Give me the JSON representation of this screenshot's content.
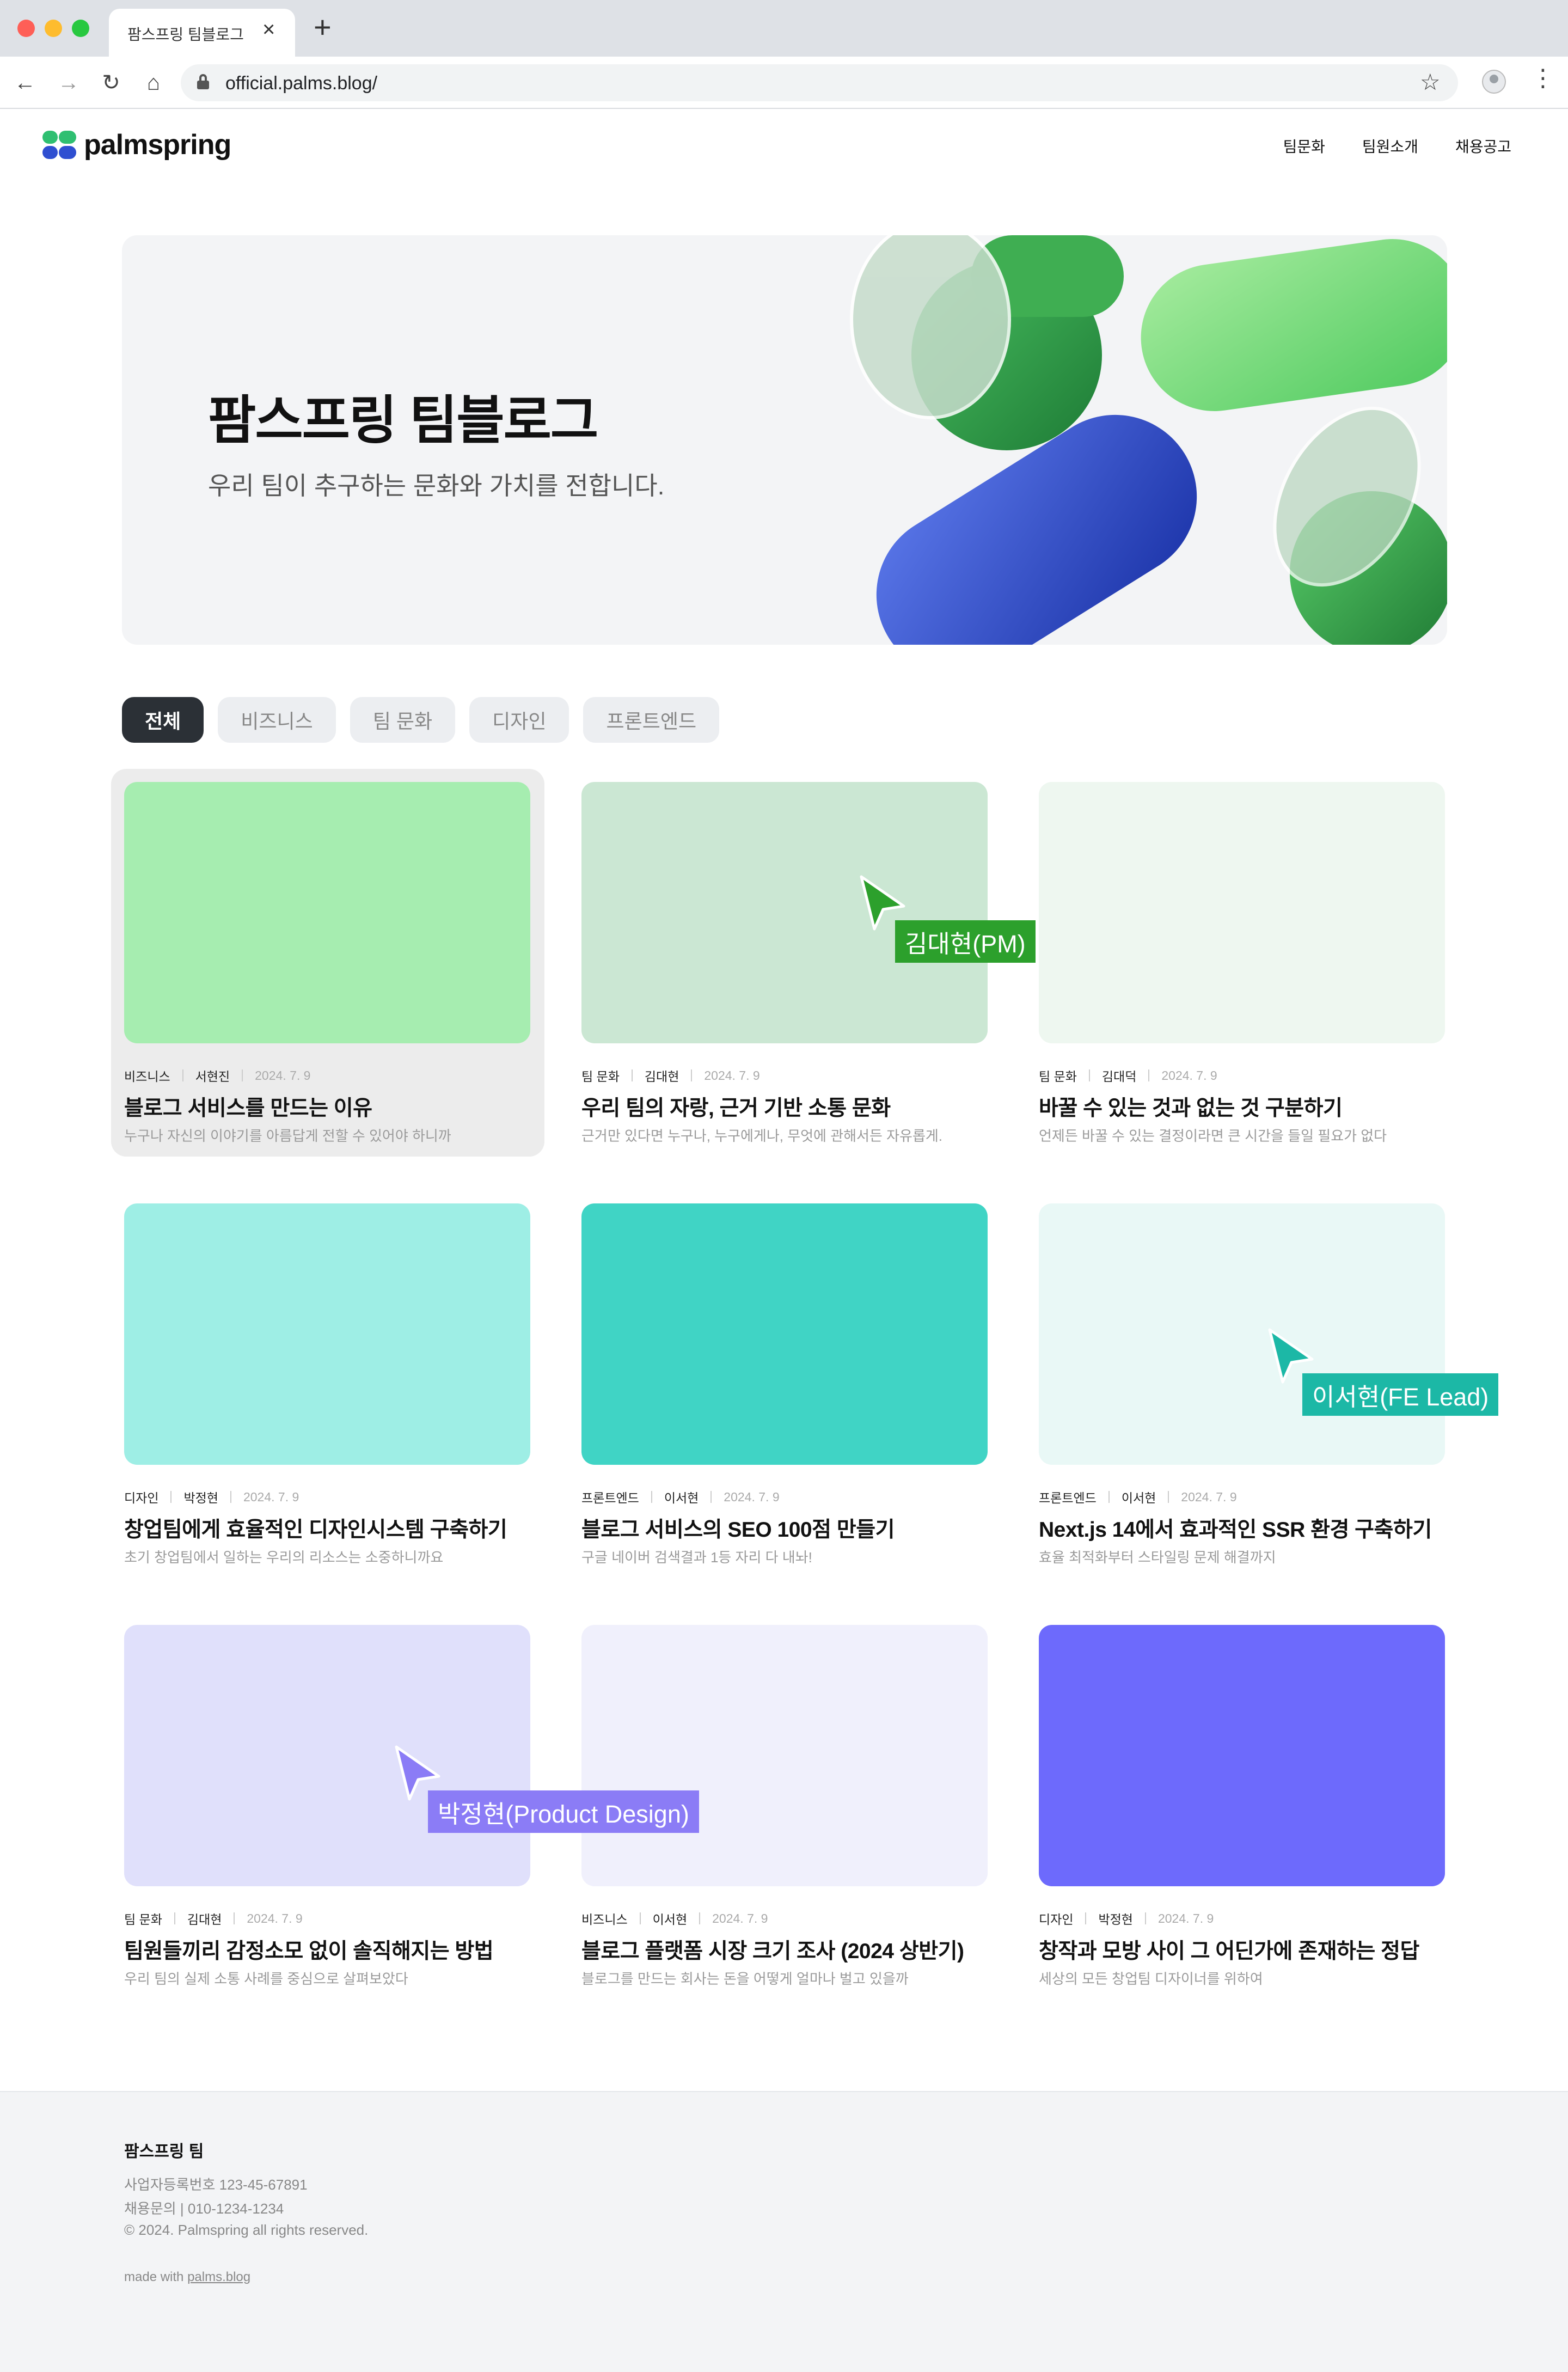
{
  "browser": {
    "tab_title": "팜스프링 팀블로그",
    "url": "official.palms.blog/"
  },
  "site": {
    "logo_text": "palmspring",
    "nav": [
      {
        "label": "팀문화"
      },
      {
        "label": "팀원소개"
      },
      {
        "label": "채용공고"
      }
    ]
  },
  "hero": {
    "title": "팜스프링 팀블로그",
    "subtitle": "우리 팀이 추구하는 문화와 가치를 전합니다."
  },
  "categories": [
    {
      "label": "전체",
      "active": true
    },
    {
      "label": "비즈니스"
    },
    {
      "label": "팀 문화"
    },
    {
      "label": "디자인"
    },
    {
      "label": "프론트엔드"
    }
  ],
  "posts": [
    {
      "category": "비즈니스",
      "author": "서현진",
      "date": "2024. 7. 9",
      "title": "블로그 서비스를 만드는 이유",
      "excerpt": "누구나 자신의 이야기를 아름답게 전할 수 있어야 하니까",
      "thumb_color": "#a6edb0",
      "hovered": true
    },
    {
      "category": "팀 문화",
      "author": "김대현",
      "date": "2024. 7. 9",
      "title": "우리 팀의 자랑, 근거 기반 소통 문화",
      "excerpt": "근거만 있다면 누구나, 누구에게나, 무엇에 관해서든 자유롭게.",
      "thumb_color": "#cbe7d3"
    },
    {
      "category": "팀 문화",
      "author": "김대덕",
      "date": "2024. 7. 9",
      "title": "바꿀 수 있는 것과 없는 것 구분하기",
      "excerpt": "언제든 바꿀 수 있는 결정이라면 큰 시간을 들일 필요가 없다",
      "thumb_color": "#eef7f0"
    },
    {
      "category": "디자인",
      "author": "박정현",
      "date": "2024. 7. 9",
      "title": "창업팀에게 효율적인 디자인시스템 구축하기",
      "excerpt": "초기 창업팀에서 일하는 우리의 리소스는 소중하니까요",
      "thumb_color": "#9eeee5"
    },
    {
      "category": "프론트엔드",
      "author": "이서현",
      "date": "2024. 7. 9",
      "title": "블로그 서비스의 SEO 100점 만들기",
      "excerpt": "구글 네이버 검색결과 1등 자리 다 내놔!",
      "thumb_color": "#40d4c5"
    },
    {
      "category": "프론트엔드",
      "author": "이서현",
      "date": "2024. 7. 9",
      "title": "Next.js 14에서 효과적인 SSR 환경 구축하기",
      "excerpt": "효율 최적화부터 스타일링 문제 해결까지",
      "thumb_color": "#e9f8f6"
    },
    {
      "category": "팀 문화",
      "author": "김대현",
      "date": "2024. 7. 9",
      "title": "팀원들끼리 감정소모 없이 솔직해지는 방법",
      "excerpt": "우리 팀의 실제 소통 사례를 중심으로 살펴보았다",
      "thumb_color": "#e0e0fb"
    },
    {
      "category": "비즈니스",
      "author": "이서현",
      "date": "2024. 7. 9",
      "title": "블로그 플랫폼 시장 크기 조사 (2024 상반기)",
      "excerpt": "블로그를 만드는 회사는 돈을 어떻게 얼마나 벌고 있을까",
      "thumb_color": "#f0f0fc"
    },
    {
      "category": "디자인",
      "author": "박정현",
      "date": "2024. 7. 9",
      "title": "창작과 모방 사이 그 어딘가에 존재하는 정답",
      "excerpt": "세상의 모든 창업팀 디자이너를 위하여",
      "thumb_color": "#6d6afc"
    }
  ],
  "cursors": [
    {
      "label": "김대현(PM)",
      "color": "#2ca02c"
    },
    {
      "label": "이서현(FE Lead)",
      "color": "#1cb8a6"
    },
    {
      "label": "박정현(Product Design)",
      "color": "#8b7cf6"
    }
  ],
  "footer": {
    "name": "팜스프링 팀",
    "biz_no": "사업자등록번호 123-45-67891",
    "contact": "채용문의 | 010-1234-1234",
    "copyright": "© 2024. Palmspring all rights reserved.",
    "made_with_prefix": "made with",
    "made_with_link": "palms.blog"
  },
  "icons": {
    "back": "arrow-left-icon",
    "forward": "arrow-right-icon",
    "reload": "reload-icon",
    "home": "home-icon",
    "lock": "lock-icon",
    "bookmark": "star-icon",
    "profile": "profile-icon",
    "menu": "kebab-menu-icon"
  }
}
